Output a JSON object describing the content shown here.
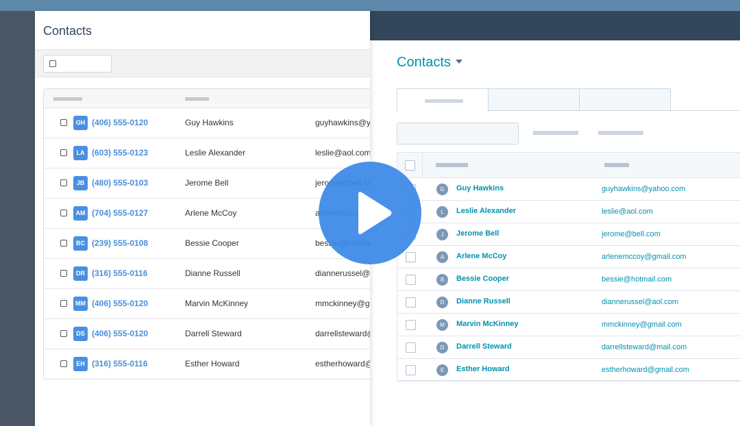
{
  "panel": {
    "title": "Contacts",
    "rows": [
      {
        "initials": "GH",
        "phone": "(406) 555-0120",
        "name": "Guy Hawkins",
        "email": "guyhawkins@y"
      },
      {
        "initials": "LA",
        "phone": "(603) 555-0123",
        "name": "Leslie Alexander",
        "email": "leslie@aol.com"
      },
      {
        "initials": "JB",
        "phone": "(480) 555-0103",
        "name": "Jerome Bell",
        "email": "jerome@bell.com"
      },
      {
        "initials": "AM",
        "phone": "(704) 555-0127",
        "name": "Arlene McCoy",
        "email": "arlenemccoy"
      },
      {
        "initials": "BC",
        "phone": "(239) 555-0108",
        "name": "Bessie Cooper",
        "email": "bessie@hotmail"
      },
      {
        "initials": "DR",
        "phone": "(316) 555-0116",
        "name": "Dianne Russell",
        "email": "diannerussel@a"
      },
      {
        "initials": "MM",
        "phone": "(406) 555-0120",
        "name": "Marvin McKinney",
        "email": "mmckinney@gm"
      },
      {
        "initials": "DS",
        "phone": "(406) 555-0120",
        "name": "Darrell Steward",
        "email": "darrellsteward@"
      },
      {
        "initials": "EH",
        "phone": "(316) 555-0116",
        "name": "Esther Howard",
        "email": "estherhoward@"
      }
    ]
  },
  "hubspot": {
    "title": "Contacts",
    "rows": [
      {
        "initial": "G",
        "name": "Guy Hawkins",
        "email": "guyhawkins@yahoo.com"
      },
      {
        "initial": "L",
        "name": "Leslie Alexander",
        "email": "leslie@aol.com"
      },
      {
        "initial": "J",
        "name": "Jerome Bell",
        "email": "jerome@bell.com"
      },
      {
        "initial": "A",
        "name": "Arlene McCoy",
        "email": "arlenemccoy@gmail.com"
      },
      {
        "initial": "B",
        "name": "Bessie Cooper",
        "email": "bessie@hotmail.com"
      },
      {
        "initial": "D",
        "name": "Dianne Russell",
        "email": "diannerussel@aol.com"
      },
      {
        "initial": "M",
        "name": "Marvin McKinney",
        "email": "mmckinney@gmail.com"
      },
      {
        "initial": "D",
        "name": "Darrell Steward",
        "email": "darrellsteward@mail.com"
      },
      {
        "initial": "E",
        "name": "Esther Howard",
        "email": "estherhoward@gmail.com"
      }
    ]
  },
  "colors": {
    "accent": "#0091ae",
    "badge": "#4a90e2",
    "nav": "#33475b",
    "play": "#3a88e6"
  },
  "icons": {
    "play": "play-icon",
    "caret": "caret-down-icon"
  }
}
